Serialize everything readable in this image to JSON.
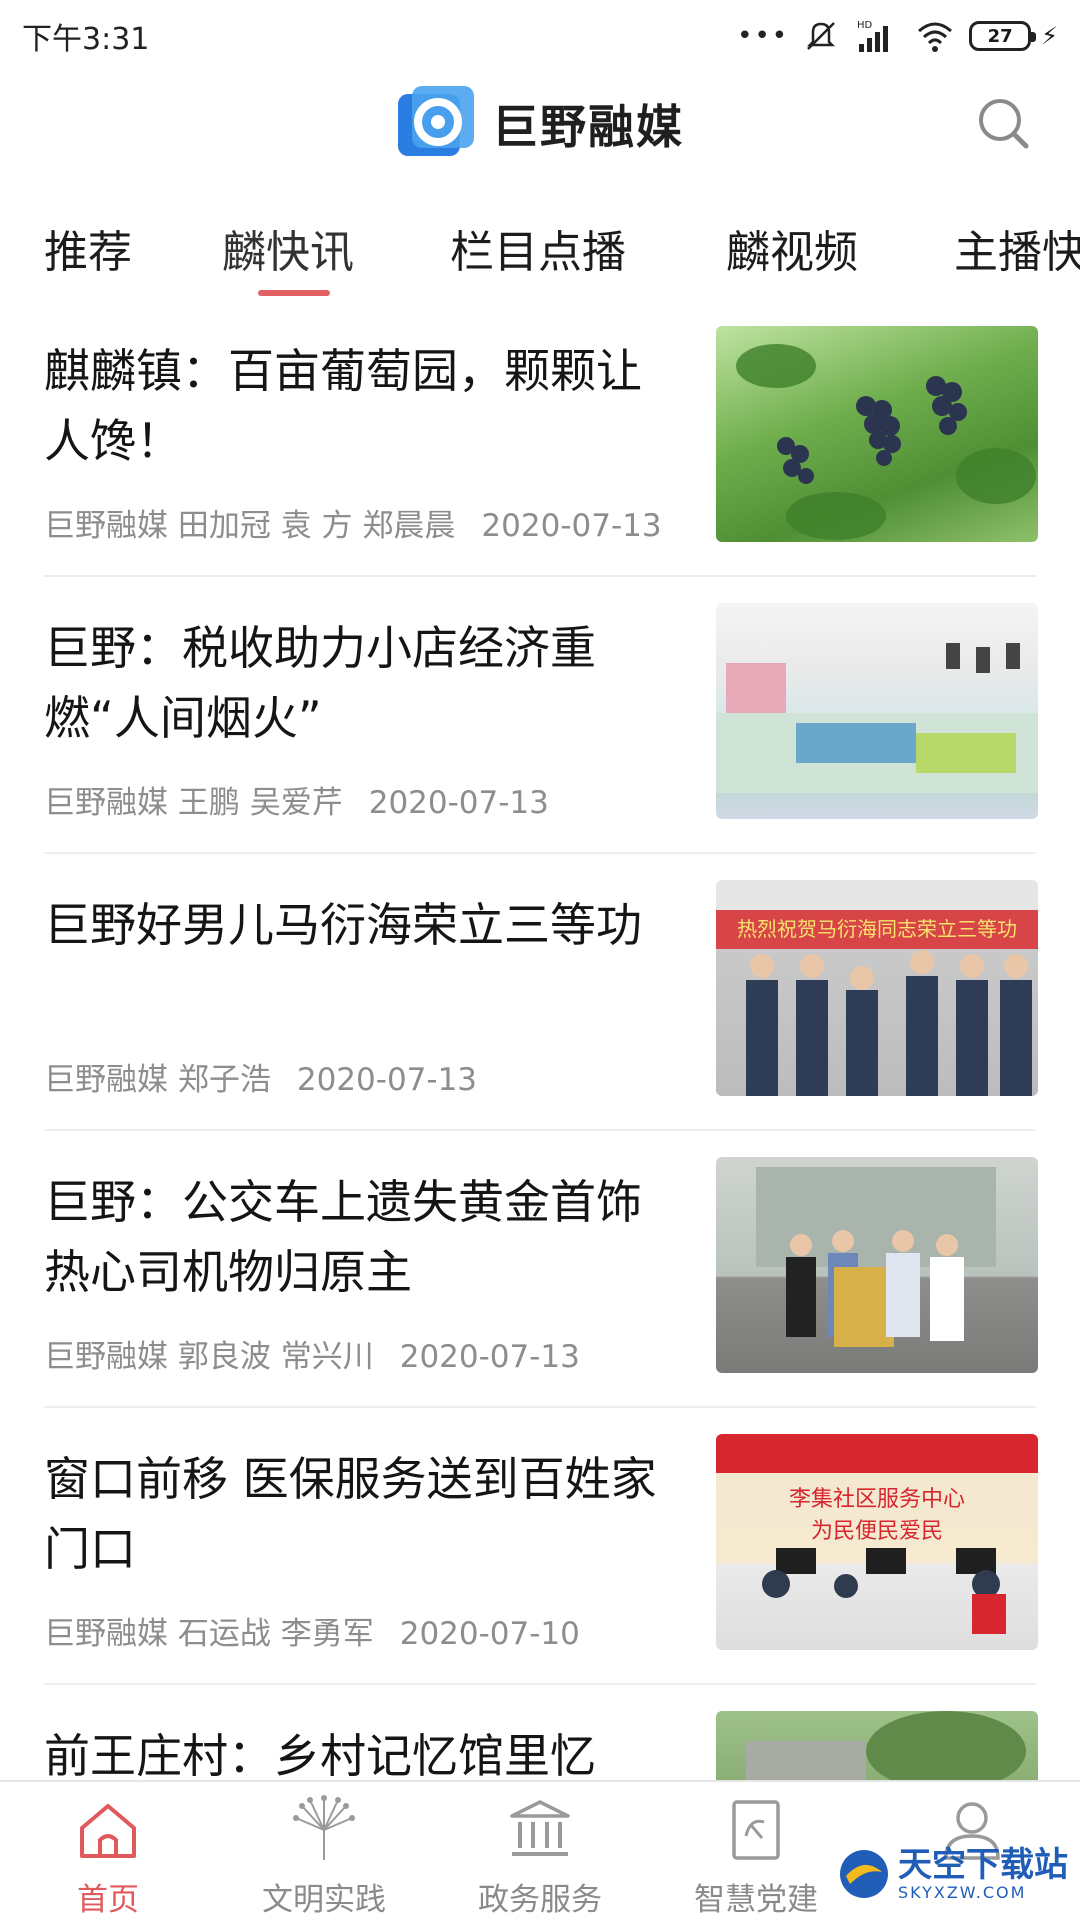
{
  "status_bar": {
    "time": "下午3:31",
    "dots": "•••",
    "battery": "27",
    "hd_label": "HD"
  },
  "header": {
    "app_name": "巨野融媒",
    "search_icon": "search-icon",
    "logo_color": "#2a7de1"
  },
  "tabs": [
    {
      "label": "推荐"
    },
    {
      "label": "麟快讯"
    },
    {
      "label": "栏目点播"
    },
    {
      "label": "麟视频"
    },
    {
      "label": "主播快"
    }
  ],
  "active_tab": "麟快讯",
  "accent_color": "#e06063",
  "feed": [
    {
      "title": "麒麟镇：百亩葡萄园，颗颗让人馋！",
      "author": "巨野融媒 田加冠 袁  方 郑晨晨",
      "date": "2020-07-13"
    },
    {
      "title": "巨野：税收助力小店经济重燃“人间烟火”",
      "author": "巨野融媒 王鹏 吴爱芹",
      "date": "2020-07-13"
    },
    {
      "title": "巨野好男儿马衍海荣立三等功",
      "author": "巨野融媒 郑子浩",
      "date": "2020-07-13"
    },
    {
      "title": "巨野：公交车上遗失黄金首饰 热心司机物归原主",
      "author": "巨野融媒 郭良波 常兴川",
      "date": "2020-07-13"
    },
    {
      "title": "窗口前移 医保服务送到百姓家门口",
      "author": "巨野融媒 石运战 李勇军",
      "date": "2020-07-10"
    },
    {
      "title": "前王庄村：乡村记忆馆里忆",
      "author": "",
      "date": ""
    }
  ],
  "thumb_texts": {
    "award_banner": "热烈祝贺马衍海同志荣立三等功",
    "service_sign1": "李集社区服务中心",
    "service_sign2": "为民便民爱民"
  },
  "bottom_nav": [
    {
      "label": "首页",
      "icon": "home-icon"
    },
    {
      "label": "文明实践",
      "icon": "peacock-icon"
    },
    {
      "label": "政务服务",
      "icon": "government-building-icon"
    },
    {
      "label": "智慧党建",
      "icon": "party-book-icon"
    },
    {
      "label": "我的",
      "icon": "user-icon"
    }
  ],
  "watermark": {
    "text": "天空下载站",
    "sub": "SKYXZW.COM"
  }
}
